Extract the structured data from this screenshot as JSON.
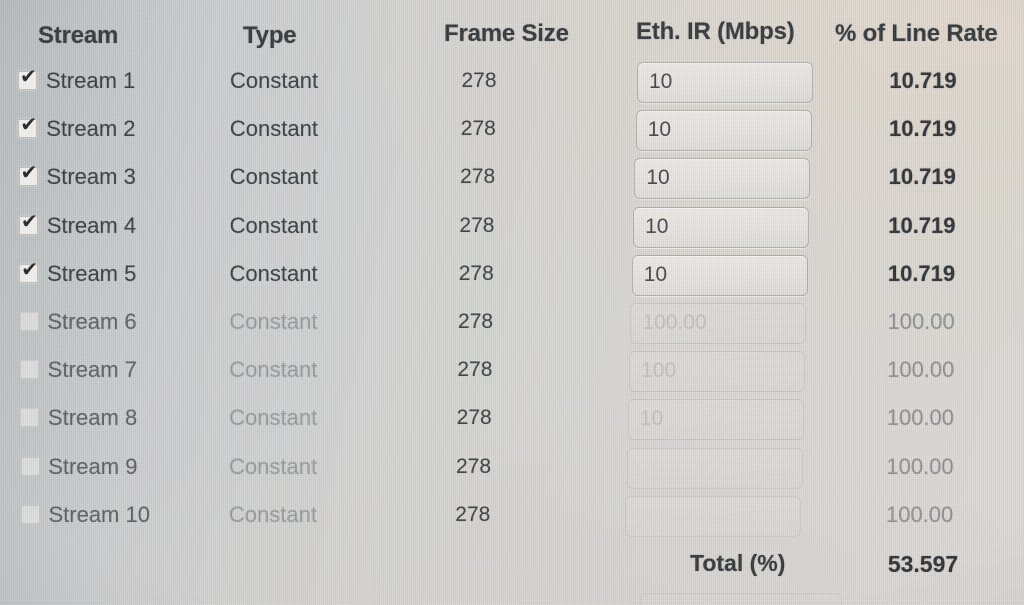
{
  "header": {
    "columns": [
      {
        "key": "stream",
        "label": "Stream"
      },
      {
        "key": "type",
        "label": "Type"
      },
      {
        "key": "framesize",
        "label": "Frame Size"
      },
      {
        "key": "ethir",
        "label": "Eth. IR (Mbps)"
      },
      {
        "key": "linerate",
        "label": "% of Line Rate"
      }
    ]
  },
  "rows": [
    {
      "checked": true,
      "check_glyph": "✔",
      "stream": "Stream 1",
      "type": "Constant",
      "frame_size": "278",
      "eth_ir": "10",
      "eth_ir_placeholder": "",
      "line_rate": "10.719",
      "enabled": true
    },
    {
      "checked": true,
      "check_glyph": "✔",
      "stream": "Stream 2",
      "type": "Constant",
      "frame_size": "278",
      "eth_ir": "10",
      "eth_ir_placeholder": "",
      "line_rate": "10.719",
      "enabled": true
    },
    {
      "checked": true,
      "check_glyph": "✔",
      "stream": "Stream 3",
      "type": "Constant",
      "frame_size": "278",
      "eth_ir": "10",
      "eth_ir_placeholder": "",
      "line_rate": "10.719",
      "enabled": true
    },
    {
      "checked": true,
      "check_glyph": "✔",
      "stream": "Stream 4",
      "type": "Constant",
      "frame_size": "278",
      "eth_ir": "10",
      "eth_ir_placeholder": "",
      "line_rate": "10.719",
      "enabled": true
    },
    {
      "checked": true,
      "check_glyph": "✔",
      "stream": "Stream 5",
      "type": "Constant",
      "frame_size": "278",
      "eth_ir": "10",
      "eth_ir_placeholder": "",
      "line_rate": "10.719",
      "enabled": true
    },
    {
      "checked": false,
      "check_glyph": "",
      "stream": "Stream 6",
      "type": "Constant",
      "frame_size": "278",
      "eth_ir": "100.00",
      "eth_ir_placeholder": "",
      "line_rate": "100.00",
      "enabled": false
    },
    {
      "checked": false,
      "check_glyph": "",
      "stream": "Stream 7",
      "type": "Constant",
      "frame_size": "278",
      "eth_ir": "100",
      "eth_ir_placeholder": "",
      "line_rate": "100.00",
      "enabled": false
    },
    {
      "checked": false,
      "check_glyph": "",
      "stream": "Stream 8",
      "type": "Constant",
      "frame_size": "278",
      "eth_ir": "10",
      "eth_ir_placeholder": "",
      "line_rate": "100.00",
      "enabled": false
    },
    {
      "checked": false,
      "check_glyph": "",
      "stream": "Stream 9",
      "type": "Constant",
      "frame_size": "278",
      "eth_ir": "",
      "eth_ir_placeholder": "",
      "line_rate": "100.00",
      "enabled": false
    },
    {
      "checked": false,
      "check_glyph": "",
      "stream": "Stream 10",
      "type": "Constant",
      "frame_size": "278",
      "eth_ir": "",
      "eth_ir_placeholder": "",
      "line_rate": "100.00",
      "enabled": false
    }
  ],
  "total": {
    "label": "Total (%)",
    "value": "53.597"
  },
  "colors": {
    "text_primary": "#35393c",
    "text_disabled": "#9a9c9d",
    "background": "#d4d5d3",
    "field_background": "#eceae6",
    "field_border": "#9e9e9c"
  }
}
